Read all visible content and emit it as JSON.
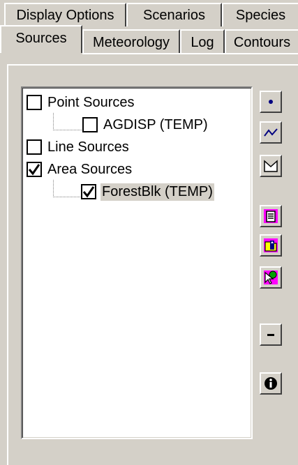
{
  "tabs": {
    "row1": [
      {
        "label": "Display Options"
      },
      {
        "label": "Scenarios"
      },
      {
        "label": "Species"
      }
    ],
    "row2": [
      {
        "label": "Sources",
        "active": true
      },
      {
        "label": "Meteorology"
      },
      {
        "label": "Log"
      },
      {
        "label": "Contours"
      }
    ]
  },
  "tree": [
    {
      "label": "Point Sources",
      "checked": false
    },
    {
      "label": "AGDISP (TEMP)",
      "checked": false,
      "child": true
    },
    {
      "label": "Line Sources",
      "checked": false
    },
    {
      "label": "Area Sources",
      "checked": true
    },
    {
      "label": "ForestBlk (TEMP)",
      "checked": true,
      "child": true,
      "selected": true
    }
  ],
  "toolbar": [
    {
      "name": "point-source-button",
      "icon": "dot-icon"
    },
    {
      "name": "line-source-button",
      "icon": "polyline-icon"
    },
    {
      "name": "area-source-button",
      "icon": "polygon-icon"
    },
    {
      "name": "properties-button",
      "icon": "document-icon"
    },
    {
      "name": "import-button",
      "icon": "import-icon"
    },
    {
      "name": "select-button",
      "icon": "pointer-icon"
    },
    {
      "name": "remove-button",
      "icon": "minus-icon"
    },
    {
      "name": "info-button",
      "icon": "info-icon"
    }
  ],
  "colors": {
    "face": "#d4d0c8",
    "accent_magenta": "#ff00ff",
    "accent_blue": "#000080",
    "accent_yellow": "#ffff00"
  }
}
